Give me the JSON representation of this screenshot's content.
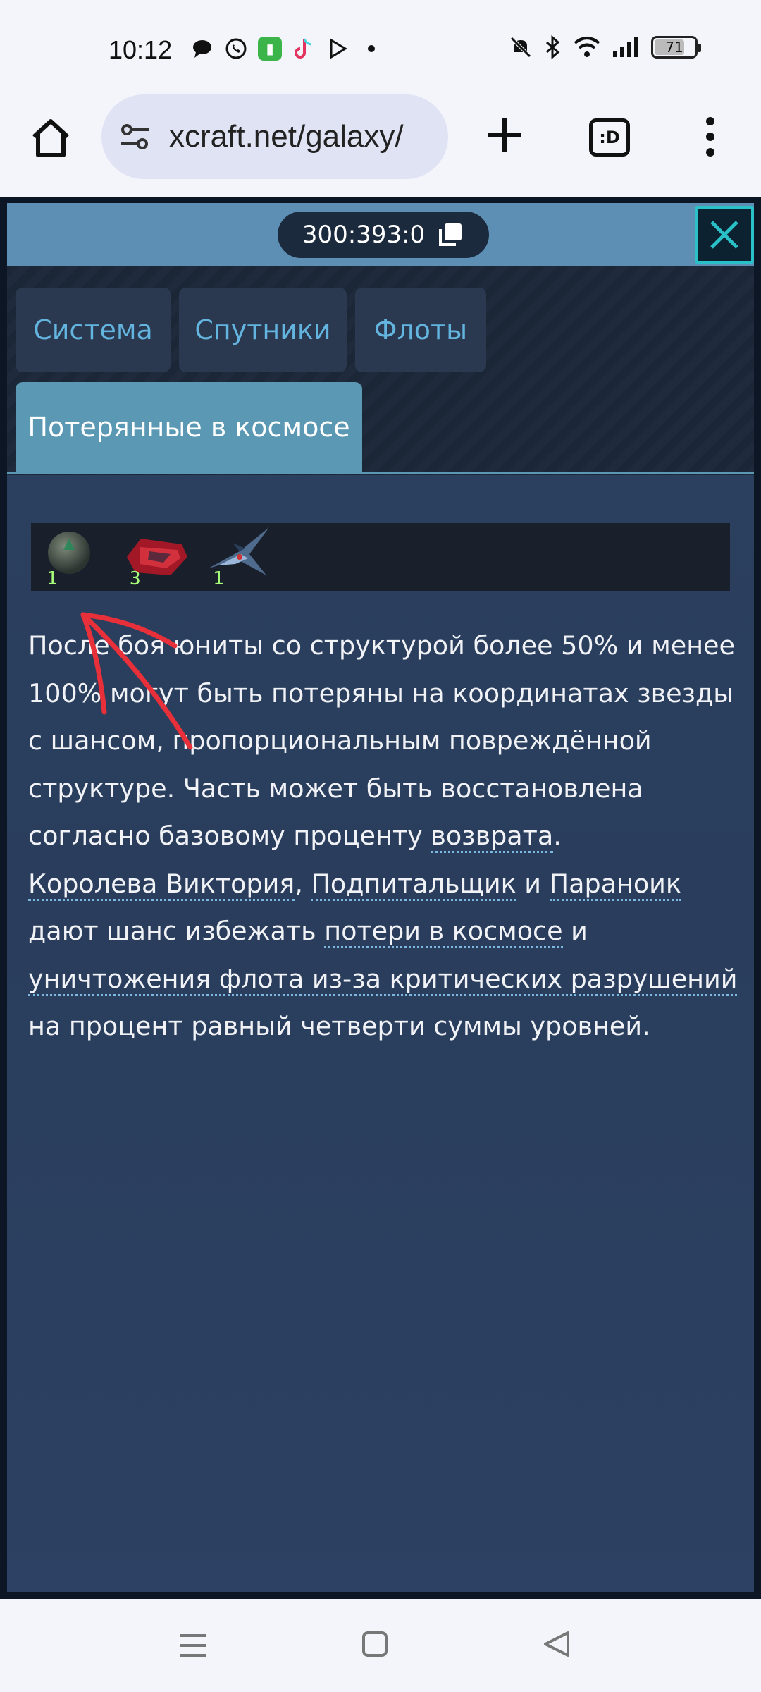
{
  "status_bar": {
    "time": "10:12",
    "battery": "71"
  },
  "browser": {
    "url": "xcraft.net/galaxy/",
    "tab_switcher_label": ":D"
  },
  "panel": {
    "coordinates": "300:393:0",
    "tabs": [
      {
        "label": "Система"
      },
      {
        "label": "Спутники"
      },
      {
        "label": "Флоты"
      },
      {
        "label": "Потерянные в космосе"
      }
    ],
    "units": [
      {
        "icon": "sphere-ship-icon",
        "count": "1"
      },
      {
        "icon": "red-cruiser-icon",
        "count": "3"
      },
      {
        "icon": "fighter-icon",
        "count": "1"
      }
    ],
    "description": {
      "t1": "После боя юниты со структурой более 50% и менее 100% могут быть потеряны на координатах звезды с шансом, пропорциональным повреждённой структуре. Часть может быть восстановлена согласно базовому проценту ",
      "l1": "возврата",
      "t2": ".",
      "l2": "Королева Виктория",
      "t3": ", ",
      "l3": "Подпитальщик",
      "t4": " и ",
      "l4": "Параноик",
      "t5": " дают шанс избежать ",
      "l5": "потери в космосе",
      "t6": " и ",
      "l6": "уничтожения флота из-за критических разрушений",
      "t7": " на процент равный четверти суммы уровней."
    }
  },
  "colors": {
    "accent": "#5b98b3",
    "tab_text": "#63b4de",
    "unit_count": "#a8ff7a",
    "annotation": "#e8303a"
  }
}
